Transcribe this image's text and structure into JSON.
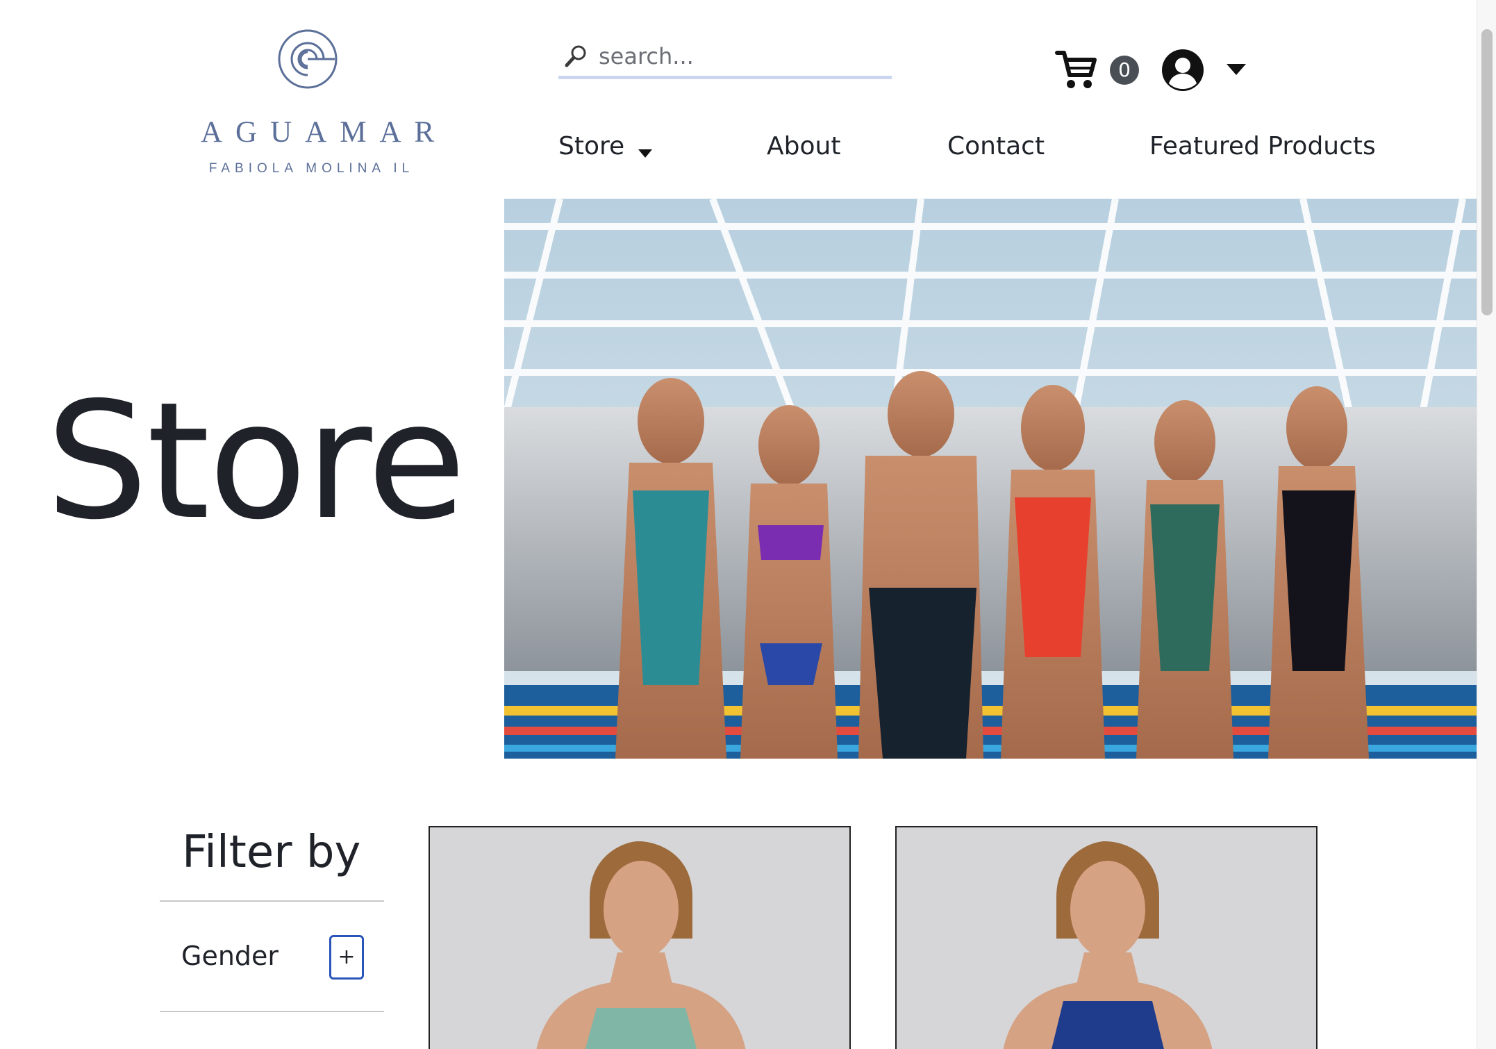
{
  "header": {
    "logo_name": "AGUAMAR",
    "logo_subtitle": "FABIOLA MOLINA IL",
    "brand_color": "#5b6f99"
  },
  "search": {
    "placeholder": "search..."
  },
  "cart": {
    "count": "0"
  },
  "nav": {
    "items": [
      {
        "label": "Store"
      },
      {
        "label": "About"
      },
      {
        "label": "Contact"
      },
      {
        "label": "Featured Products"
      }
    ]
  },
  "hero": {
    "title": "Store"
  },
  "filter": {
    "title": "Filter by",
    "groups": [
      {
        "label": "Gender",
        "toggle": "+"
      }
    ]
  },
  "products": [
    {
      "swimsuit_color": "#7fb6a5"
    },
    {
      "swimsuit_color": "#1f3c8c"
    }
  ],
  "colors": {
    "accent": "#2a55b8",
    "text": "#1f2329",
    "search_underline": "#c9d6ee",
    "badge": "#4a4f55"
  }
}
